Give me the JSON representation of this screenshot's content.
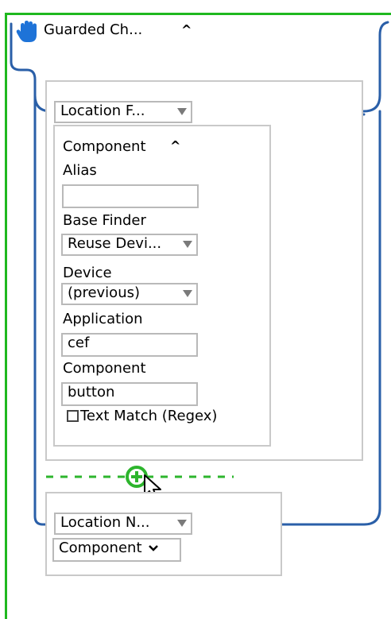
{
  "guarded_block": {
    "title": "Guarded Ch...",
    "hand_icon": "hand-icon",
    "collapse_icon": "caret-up-icon"
  },
  "finder_one": {
    "dropdown_label": "Location F...",
    "section_title": "Component",
    "fields": {
      "alias_label": "Alias",
      "alias_value": "",
      "base_finder_label": "Base Finder",
      "base_finder_value": "Reuse Devi...",
      "device_label": "Device",
      "device_value": "(previous)",
      "application_label": "Application",
      "application_value": "cef",
      "component_label": "Component",
      "component_value": "button",
      "text_match_label": "Text Match (Regex)",
      "text_match_checked": false
    }
  },
  "add_button": {
    "icon": "plus-circle-icon"
  },
  "finder_two": {
    "dropdown_label": "Location N...",
    "component_dropdown_label": "Component"
  },
  "colors": {
    "frame_green": "#1fb81f",
    "wire_blue": "#2a5fa8",
    "hand_blue": "#1e73d8",
    "add_green": "#2db52d"
  }
}
